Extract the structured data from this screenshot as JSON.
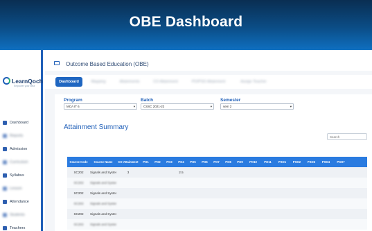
{
  "hero": {
    "title": "OBE Dashboard"
  },
  "sidebar": {
    "logo": "LearnQoch",
    "logo_tagline": "Empower your idea",
    "items": [
      {
        "label": "Dashboard",
        "icon": "grid-icon",
        "blurred": false
      },
      {
        "label": "Reports",
        "icon": "chart-icon",
        "blurred": true
      },
      {
        "label": "Admission",
        "icon": "admission-icon",
        "blurred": false
      },
      {
        "label": "Curriculum",
        "icon": "book-icon",
        "blurred": true
      },
      {
        "label": "Syllabus",
        "icon": "syllabus-icon",
        "blurred": false
      },
      {
        "label": "Lesson",
        "icon": "lesson-icon",
        "blurred": true
      },
      {
        "label": "Attendance",
        "icon": "attendance-icon",
        "blurred": false
      },
      {
        "label": "Students",
        "icon": "students-icon",
        "blurred": true
      },
      {
        "label": "Teachers",
        "icon": "teachers-icon",
        "blurred": false
      }
    ]
  },
  "header": {
    "title": "Outcome Based Education (OBE)"
  },
  "tabs": [
    {
      "label": "Dashboard",
      "active": true
    },
    {
      "label": "Mapping",
      "active": false
    },
    {
      "label": "Attainments",
      "active": false
    },
    {
      "label": "CO Attainment",
      "active": false
    },
    {
      "label": "PO/PSO Attainment",
      "active": false
    },
    {
      "label": "Assign Teacher",
      "active": false
    }
  ],
  "filters": {
    "program": {
      "label": "Program",
      "value": "MCA IT 6"
    },
    "batch": {
      "label": "Batch",
      "value": "CSSC 2021-22"
    },
    "semester": {
      "label": "Semester",
      "value": "sem 2"
    }
  },
  "summary": {
    "title": "Attainment Summary"
  },
  "search": {
    "placeholder": "Search"
  },
  "table": {
    "headers": [
      "Course Code",
      "Course Name",
      "CO Attainment",
      "PO1",
      "PO2",
      "PO3",
      "PO4",
      "PO5",
      "PO6",
      "PO7",
      "PO8",
      "PO9",
      "PO10",
      "PO11",
      "PSO1",
      "PSO2",
      "PSO3",
      "PSO4",
      "PSO7"
    ],
    "rows": [
      {
        "code": "SC202",
        "name": "Signals and Systems",
        "co": "3",
        "po4": "2.5",
        "blurred": false
      },
      {
        "code": "SC202",
        "name": "Signals and Systems",
        "co": "",
        "po4": "",
        "blurred": true
      },
      {
        "code": "SC202",
        "name": "Signals and Systems",
        "co": "",
        "po4": "",
        "blurred": false
      },
      {
        "code": "SC202",
        "name": "Signals and Systems",
        "co": "",
        "po4": "",
        "blurred": true
      },
      {
        "code": "SC202",
        "name": "Signals and Systems",
        "co": "",
        "po4": "",
        "blurred": false
      },
      {
        "code": "SC202",
        "name": "Signals and Systems",
        "co": "",
        "po4": "",
        "blurred": true
      }
    ]
  }
}
